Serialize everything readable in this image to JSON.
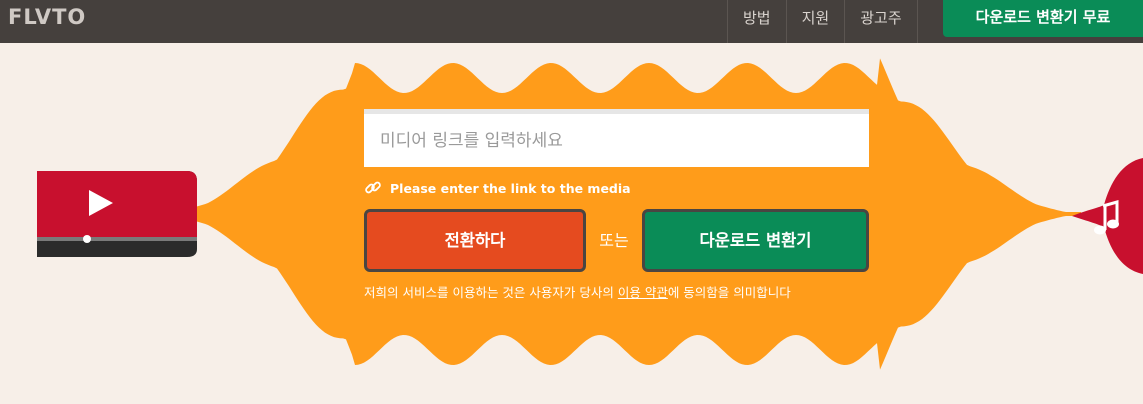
{
  "header": {
    "logo": "FLVTO",
    "nav": [
      {
        "label": "방법"
      },
      {
        "label": "지원"
      },
      {
        "label": "광고주"
      }
    ],
    "download_button": "다운로드 변환기 무료"
  },
  "form": {
    "input_placeholder": "미디어 링크를 입력하세요",
    "input_value": "",
    "hint": "Please enter the link to the media",
    "convert_button": "전환하다",
    "or_text": "또는",
    "download_button": "다운로드 변환기",
    "terms_before": "저희의 서비스를 이용하는 것은 사용자가 당사의 ",
    "terms_link": "이용 약관",
    "terms_after": "에 동의함을 의미합니다"
  },
  "colors": {
    "header_bg": "#45403d",
    "background": "#f7efe8",
    "wave_orange": "#ff9c1a",
    "convert_red": "#e54b1f",
    "download_green": "#0a8c57",
    "youtube_red": "#c8102e"
  },
  "icons": {
    "source": "youtube-video-icon",
    "target": "music-note-icon",
    "hint": "link-icon"
  }
}
